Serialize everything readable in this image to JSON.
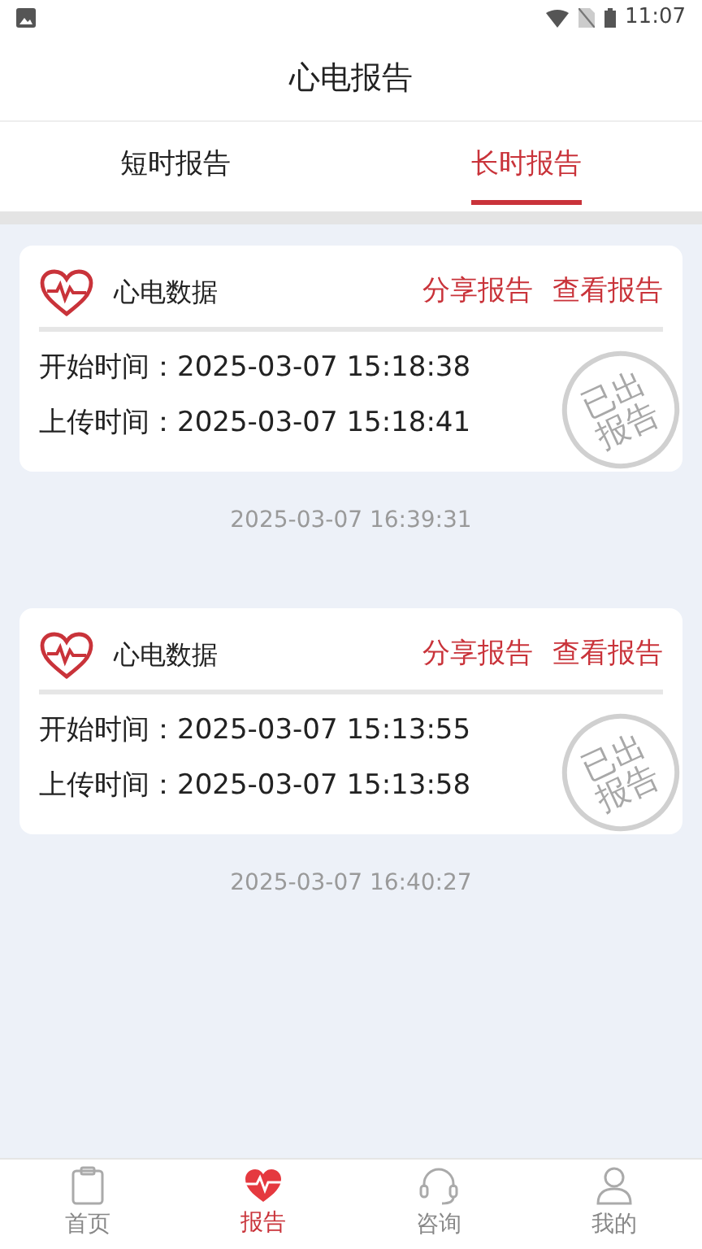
{
  "status_bar": {
    "time": "11:07"
  },
  "header": {
    "title": "心电报告"
  },
  "tabs": [
    {
      "label": "短时报告",
      "selected": false
    },
    {
      "label": "长时报告",
      "selected": true
    }
  ],
  "reports": [
    {
      "title": "心电数据",
      "actions": [
        "分享报告",
        "查看报告"
      ],
      "start_label": "开始时间：",
      "start": "2025-03-07 15:18:38",
      "upload_label": "上传时间：",
      "upload": "2025-03-07 15:18:41",
      "stamp": "已出报告",
      "timestamp": "2025-03-07 16:39:31"
    },
    {
      "title": "心电数据",
      "actions": [
        "分享报告",
        "查看报告"
      ],
      "start_label": "开始时间：",
      "start": "2025-03-07 15:13:55",
      "upload_label": "上传时间：",
      "upload": "2025-03-07 15:13:58",
      "stamp": "已出报告",
      "timestamp": "2025-03-07 16:40:27"
    }
  ],
  "bottom_nav": [
    {
      "label": "首页",
      "selected": false
    },
    {
      "label": "报告",
      "selected": true
    },
    {
      "label": "咨询",
      "selected": false
    },
    {
      "label": "我的",
      "selected": false
    }
  ]
}
